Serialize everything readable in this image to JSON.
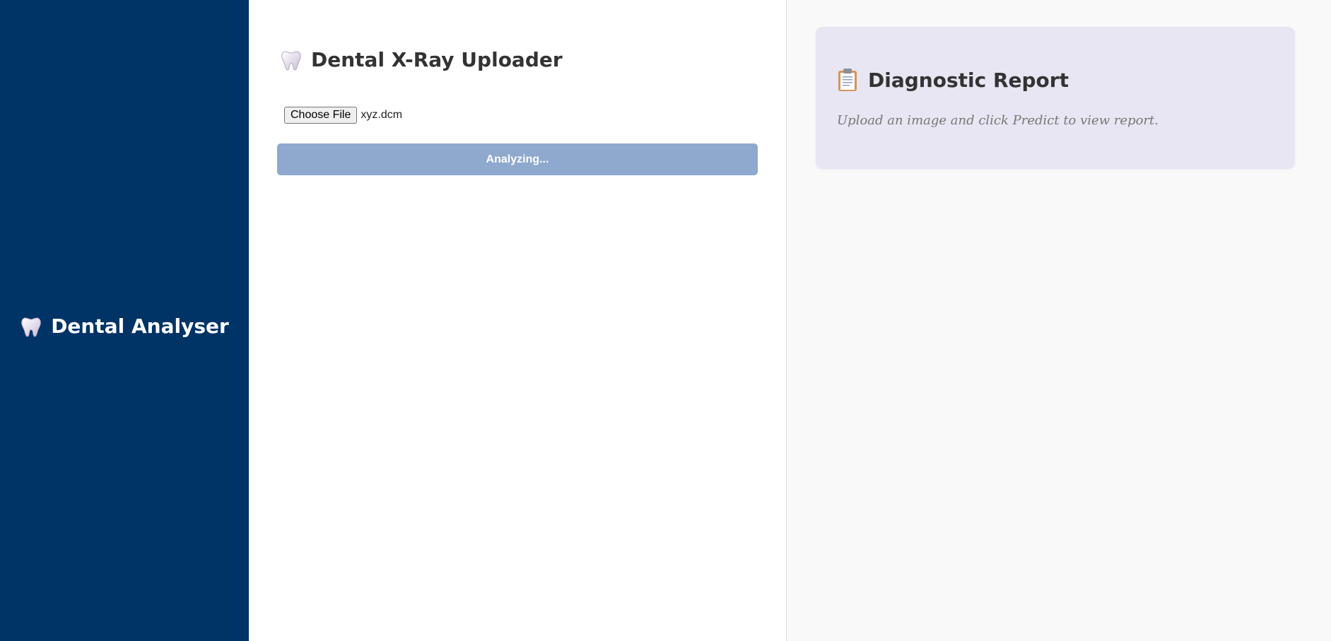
{
  "sidebar": {
    "brand_icon": "tooth-icon",
    "brand_label": "Dental Analyser",
    "background_color": "#003366"
  },
  "uploader": {
    "title_icon": "tooth-icon",
    "title": "Dental X-Ray Uploader",
    "choose_file_label": "Choose File",
    "file_name": "xyz.dcm",
    "analyze_button_label": "Analyzing...",
    "analyze_button_color": "#8ea9cd"
  },
  "report": {
    "title_icon": "clipboard-icon",
    "title": "Diagnostic Report",
    "placeholder": "Upload an image and click Predict to view report.",
    "card_color": "#e8e6f2"
  }
}
